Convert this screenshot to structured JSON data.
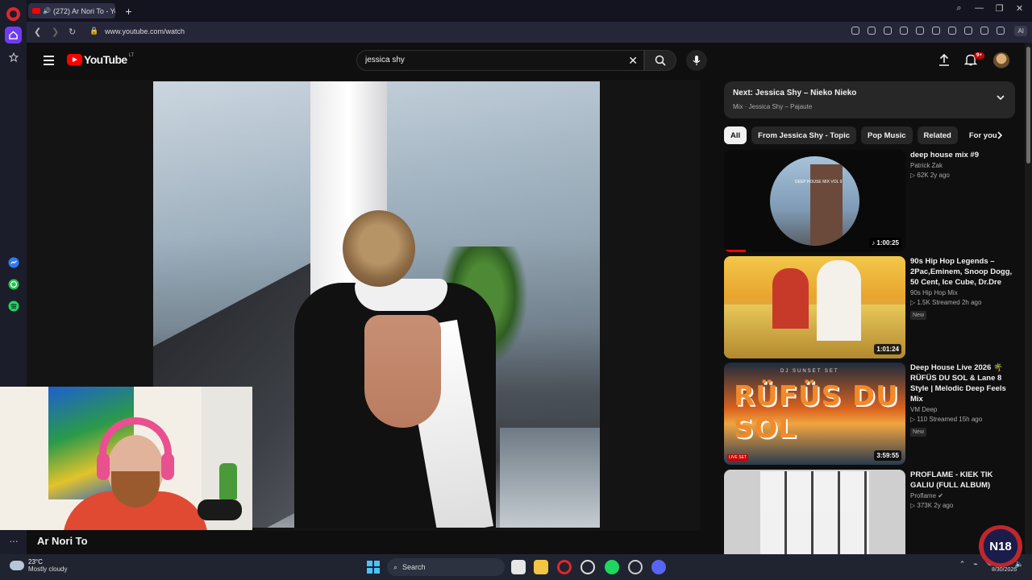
{
  "browser": {
    "tab_title": "(272) Ar Nori To - You",
    "url": "www.youtube.com/watch",
    "ai_label": "AI"
  },
  "youtube": {
    "logo_text": "YouTube",
    "country_code": "LT",
    "search_value": "jessica shy",
    "notification_count": "9+"
  },
  "video": {
    "title": "Ar Nori To"
  },
  "up_next": {
    "title": "Next: Jessica Shy – Nieko Nieko",
    "subtitle": "Mix · Jessica Shy – Pajaute"
  },
  "chips": [
    "All",
    "From Jessica Shy - Topic",
    "Pop Music",
    "Related",
    "For you"
  ],
  "recommendations": [
    {
      "title": "deep house mix #9",
      "channel": "Patrick Zak",
      "meta": "▷ 62K   2y ago",
      "duration": "♪ 1:00:25",
      "badge": "",
      "thumb_text": "DEEP HOUSE MIX VOL 9",
      "progress": 0.12
    },
    {
      "title": "90s Hip Hop Legends – 2Pac,Eminem, Snoop Dogg, 50 Cent, Ice Cube, Dr.Dre",
      "channel": "90s Hip Hop Mix",
      "meta": "▷ 1.5K   Streamed 2h ago",
      "duration": "1:01:24",
      "badge": "New"
    },
    {
      "title": "Deep House Live 2026 🌴 RÜFÜS DU SOL & Lane 8 Style | Melodic Deep Feels Mix",
      "channel": "VM Deep",
      "meta": "▷ 110   Streamed 15h ago",
      "duration": "3:59:55",
      "badge": "New",
      "thumb_text": "RÜFÜS DU SOL",
      "thumb_sub": "DJ SUNSET SET",
      "live_badge": "LIVE SET"
    },
    {
      "title": "PROFLAME - KIEK TIK GALIU (FULL ALBUM)",
      "channel": "Proflame ✔",
      "meta": "▷ 373K   2y ago",
      "duration": "",
      "badge": ""
    }
  ],
  "taskbar": {
    "temp": "23°C",
    "weather": "Mostly cloudy",
    "search_placeholder": "Search",
    "date": "8/30/2026"
  },
  "watermark": "N18"
}
